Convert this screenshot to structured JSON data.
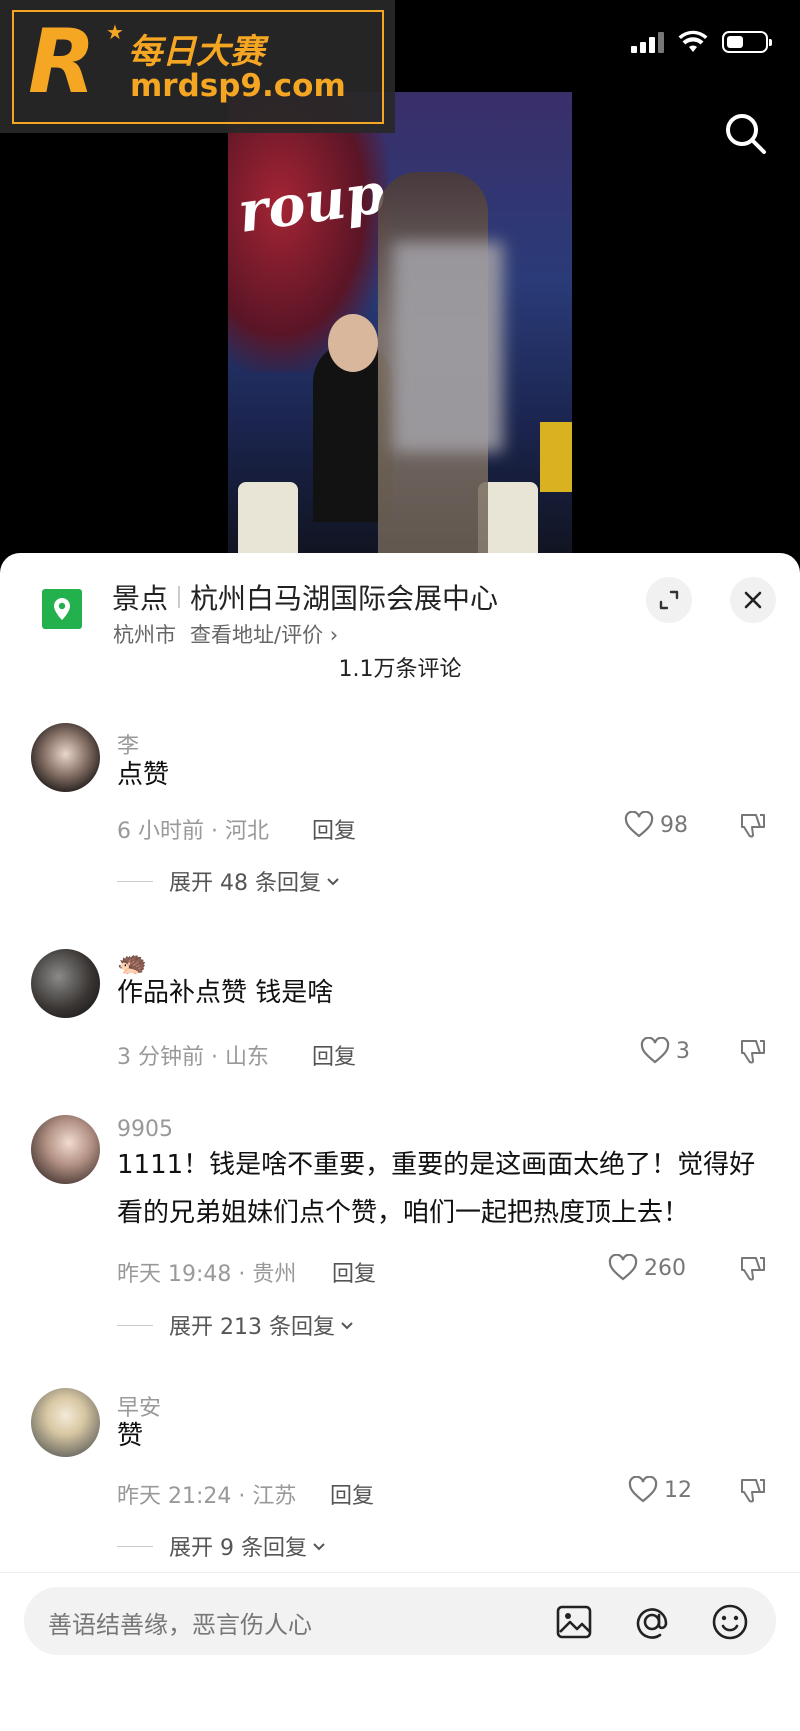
{
  "watermark": {
    "title": "每日大赛",
    "url": "mrdsp9.com"
  },
  "video": {
    "overlay_text": "roup"
  },
  "location": {
    "category": "景点",
    "name": "杭州白马湖国际会展中心",
    "city": "杭州市",
    "link": "查看地址/评价 ›"
  },
  "comment_count": "1.1万条评论",
  "comments": [
    {
      "user": "李",
      "text": "点赞",
      "time_place": "6 小时前 · 河北",
      "reply": "回复",
      "likes": "98",
      "expand": "展开 48 条回复"
    },
    {
      "user": "🦔",
      "text": "作品补点赞 钱是啥",
      "time_place": "3 分钟前 · 山东",
      "reply": "回复",
      "likes": "3",
      "expand": ""
    },
    {
      "user": "9905",
      "text": "1111！钱是啥不重要，重要的是这画面太绝了！觉得好看的兄弟姐妹们点个赞，咱们一起把热度顶上去！",
      "time_place": "昨天 19:48 · 贵州",
      "reply": "回复",
      "likes": "260",
      "expand": "展开 213 条回复"
    },
    {
      "user": "早安",
      "text": "赞",
      "time_place": "昨天 21:24 · 江苏",
      "reply": "回复",
      "likes": "12",
      "expand": "展开 9 条回复"
    }
  ],
  "input": {
    "placeholder": "善语结善缘，恶言伤人心"
  },
  "colors": {
    "location_icon": "#22b14c",
    "watermark": "#f5a623"
  },
  "icons": [
    "search-icon",
    "location-pin-icon",
    "expand-icon",
    "close-icon",
    "heart-icon",
    "dislike-icon",
    "chevron-down-icon",
    "image-icon",
    "at-icon",
    "emoji-icon"
  ]
}
